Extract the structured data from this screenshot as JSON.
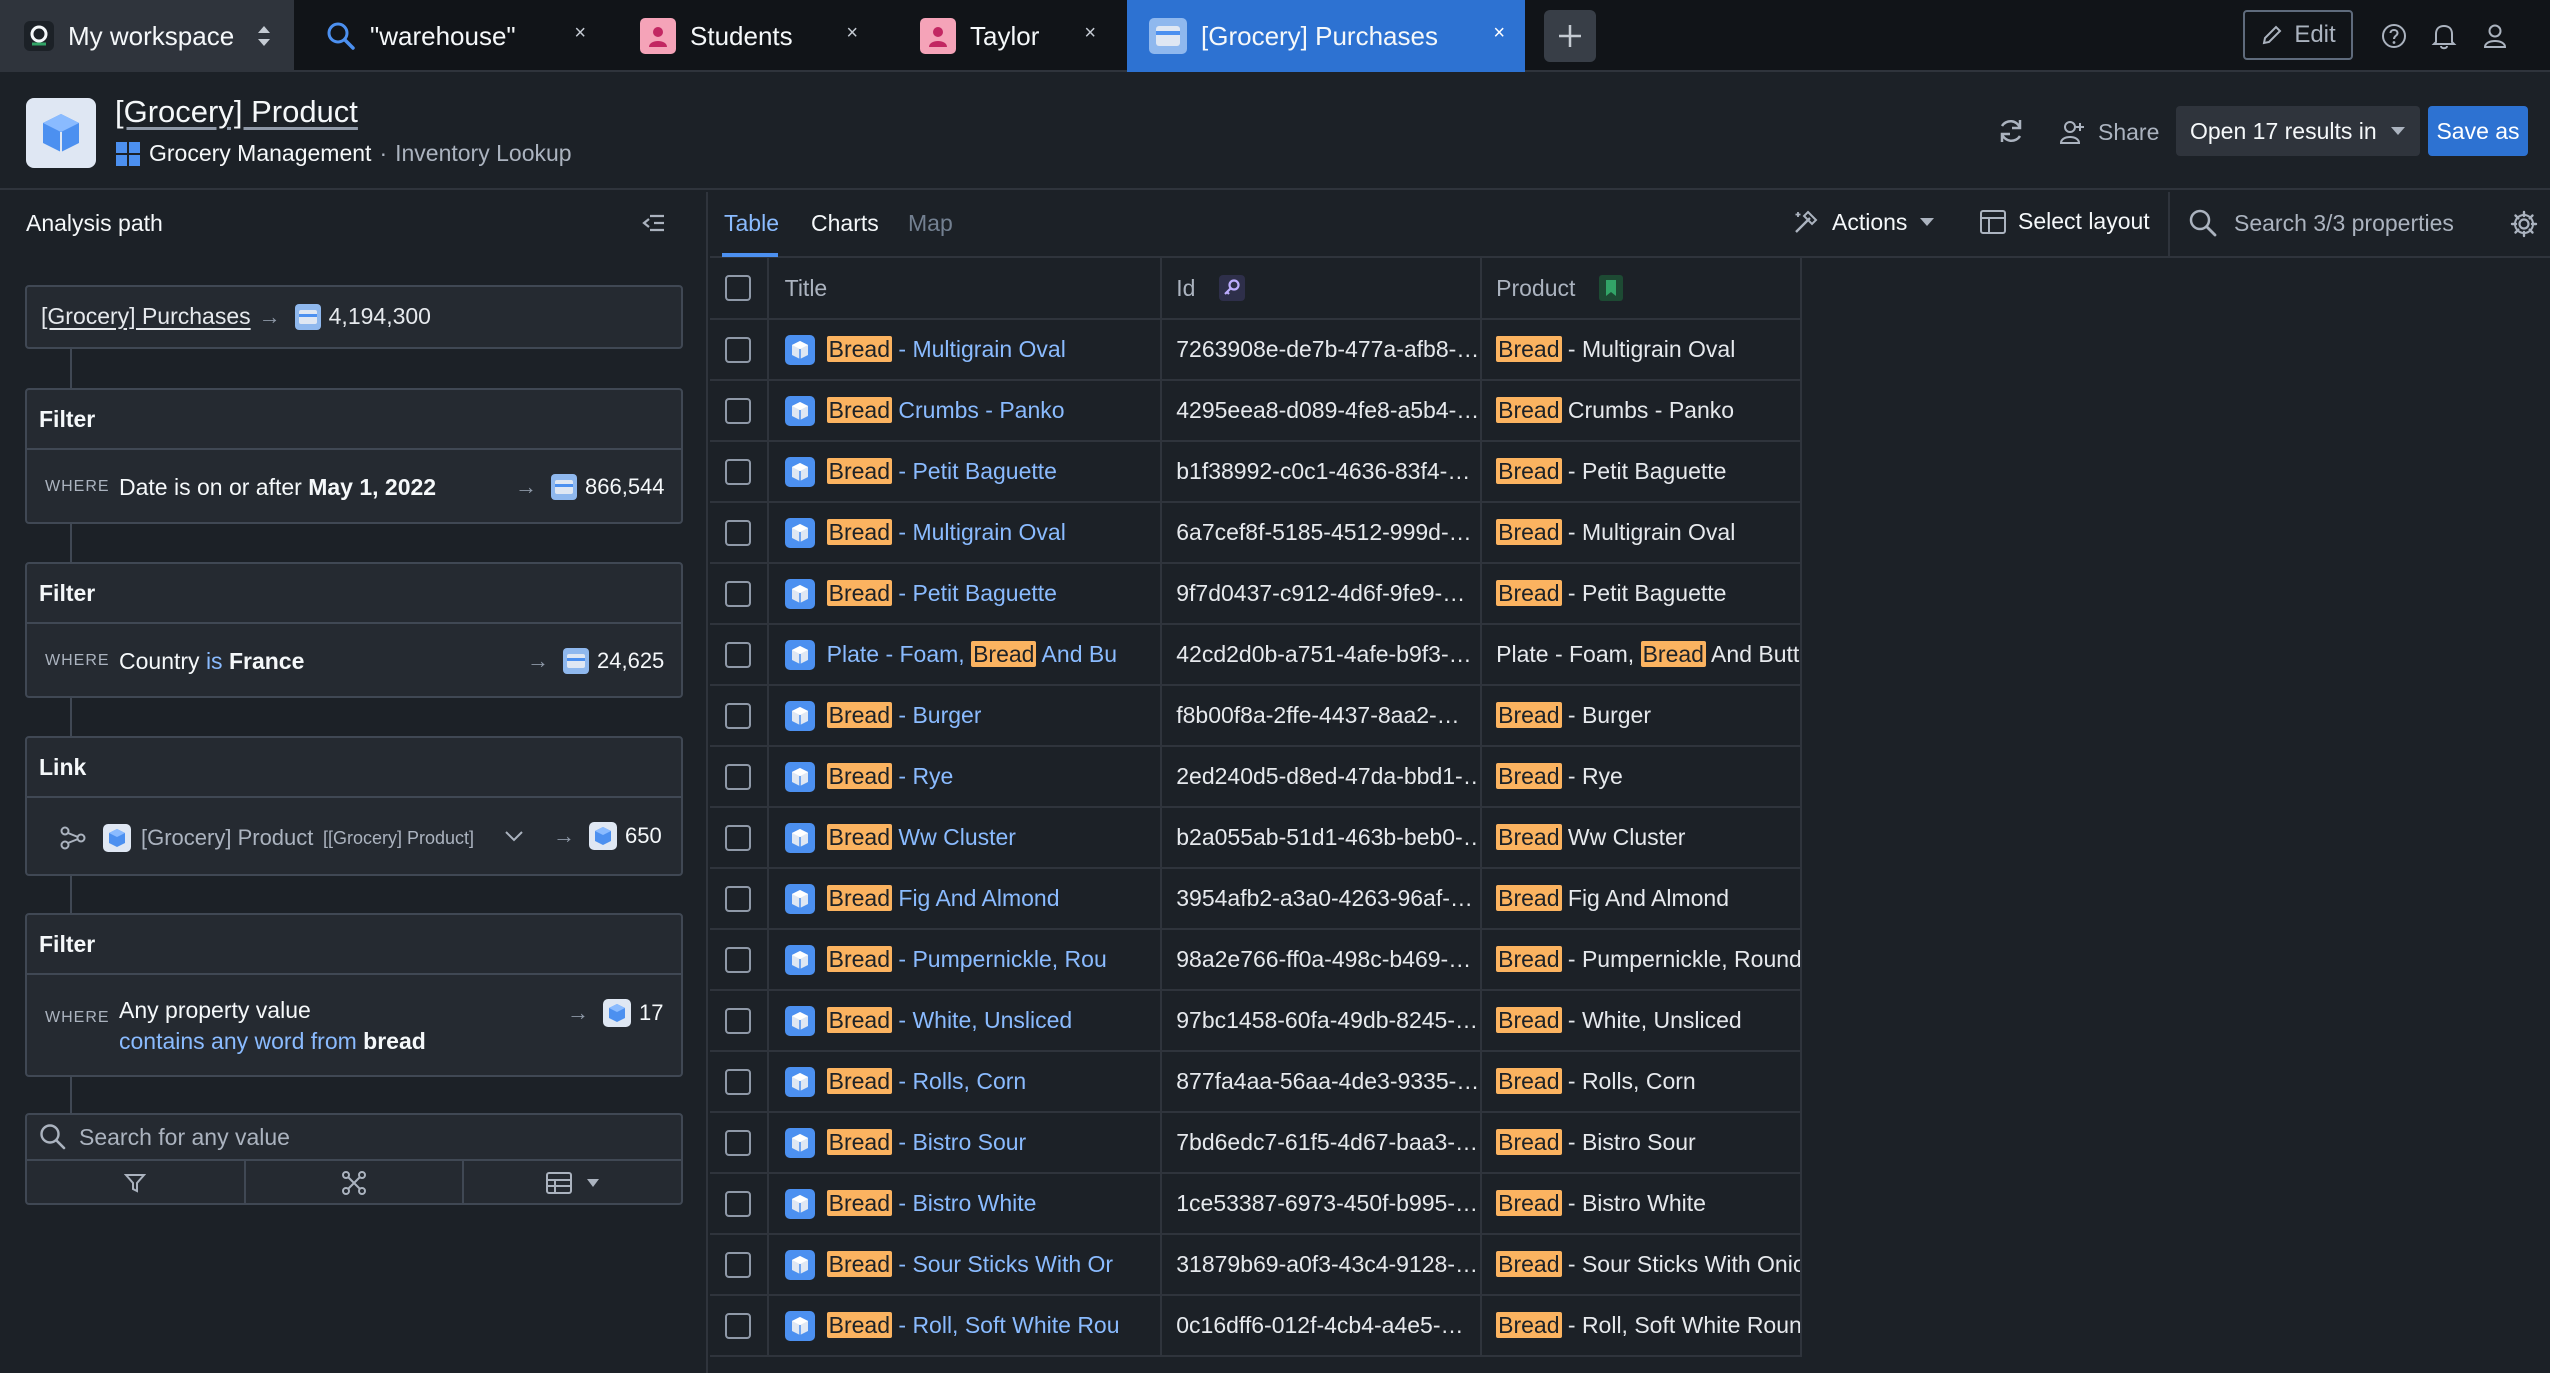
{
  "tabs": {
    "workspace": "My workspace",
    "search": "\"warehouse\"",
    "students": "Students",
    "taylor": "Taylor",
    "purchases": "[Grocery] Purchases",
    "close_glyph": "×"
  },
  "topbar": {
    "edit_label": "Edit"
  },
  "header": {
    "title": "[Grocery] Product",
    "app_name": "Grocery Management",
    "separator": "·",
    "view_name": "Inventory Lookup",
    "share_label": "Share",
    "open_results_label": "Open 17 results in",
    "save_as_label": "Save as"
  },
  "analysis": {
    "title": "Analysis path",
    "source": {
      "name": "[Grocery] Purchases",
      "count": "4,194,300"
    },
    "steps": [
      {
        "type": "Filter",
        "where": "WHERE",
        "text": "Date is on or after",
        "value": "May 1, 2022",
        "count": "866,544"
      },
      {
        "type": "Filter",
        "where": "WHERE",
        "text": "Country",
        "op": "is",
        "value": "France",
        "count": "24,625"
      },
      {
        "type": "Link",
        "object": "[Grocery] Product",
        "object_type": "[[Grocery] Product]",
        "count": "650"
      },
      {
        "type": "Filter",
        "where": "WHERE",
        "text": "Any property value",
        "op": "contains any word from",
        "value": "bread",
        "count": "17"
      }
    ],
    "search_placeholder": "Search for any value"
  },
  "view": {
    "tabs": [
      "Table",
      "Charts",
      "Map"
    ],
    "actions_label": "Actions",
    "select_layout_label": "Select layout",
    "search_properties_placeholder": "Search 3/3 properties"
  },
  "table": {
    "columns": [
      "Title",
      "Id",
      "Product"
    ],
    "rows": [
      {
        "hl": "Bread",
        "title_rest": " - Multigrain Oval",
        "id": "7263908e-de7b-477a-afb8-…",
        "product_rest": " - Multigrain Oval"
      },
      {
        "hl": "Bread",
        "title_rest": " Crumbs - Panko",
        "id": "4295eea8-d089-4fe8-a5b4-…",
        "product_rest": " Crumbs - Panko"
      },
      {
        "hl": "Bread",
        "title_rest": " - Petit Baguette",
        "id": "b1f38992-c0c1-4636-83f4-…",
        "product_rest": " - Petit Baguette"
      },
      {
        "hl": "Bread",
        "title_rest": " - Multigrain Oval",
        "id": "6a7cef8f-5185-4512-999d-…",
        "product_rest": " - Multigrain Oval"
      },
      {
        "hl": "Bread",
        "title_rest": " - Petit Baguette",
        "id": "9f7d0437-c912-4d6f-9fe9-…",
        "product_rest": " - Petit Baguette"
      },
      {
        "pre": "Plate - Foam, ",
        "hl": "Bread",
        "title_rest": " And Bu",
        "id": "42cd2d0b-a751-4afe-b9f3-…",
        "product_pre": "Plate - Foam, ",
        "product_rest": " And Butter"
      },
      {
        "hl": "Bread",
        "title_rest": " - Burger",
        "id": "f8b00f8a-2ffe-4437-8aa2-…",
        "product_rest": " - Burger"
      },
      {
        "hl": "Bread",
        "title_rest": " - Rye",
        "id": "2ed240d5-d8ed-47da-bbd1-…",
        "product_rest": " - Rye"
      },
      {
        "hl": "Bread",
        "title_rest": " Ww Cluster",
        "id": "b2a055ab-51d1-463b-beb0-…",
        "product_rest": " Ww Cluster"
      },
      {
        "hl": "Bread",
        "title_rest": " Fig And Almond",
        "id": "3954afb2-a3a0-4263-96af-…",
        "product_rest": " Fig And Almond"
      },
      {
        "hl": "Bread",
        "title_rest": " - Pumpernickle, Rou",
        "id": "98a2e766-ff0a-498c-b469-…",
        "product_rest": " - Pumpernickle, Rounds"
      },
      {
        "hl": "Bread",
        "title_rest": " - White, Unsliced",
        "id": "97bc1458-60fa-49db-8245-…",
        "product_rest": " - White, Unsliced"
      },
      {
        "hl": "Bread",
        "title_rest": " - Rolls, Corn",
        "id": "877fa4aa-56aa-4de3-9335-…",
        "product_rest": " - Rolls, Corn"
      },
      {
        "hl": "Bread",
        "title_rest": " - Bistro Sour",
        "id": "7bd6edc7-61f5-4d67-baa3-…",
        "product_rest": " - Bistro Sour"
      },
      {
        "hl": "Bread",
        "title_rest": " - Bistro White",
        "id": "1ce53387-6973-450f-b995-…",
        "product_rest": " - Bistro White"
      },
      {
        "hl": "Bread",
        "title_rest": " - Sour Sticks With Or",
        "id": "31879b69-a0f3-43c4-9128-…",
        "product_rest": " - Sour Sticks With Onion"
      },
      {
        "hl": "Bread",
        "title_rest": " - Roll, Soft White Rou",
        "id": "0c16dff6-012f-4cb4-a4e5-…",
        "product_rest": " - Roll, Soft White Round"
      }
    ]
  },
  "colors": {
    "accent": "#2d72d2",
    "link": "#8abbff",
    "highlight": "#fbb360",
    "background": "#1c2127"
  }
}
